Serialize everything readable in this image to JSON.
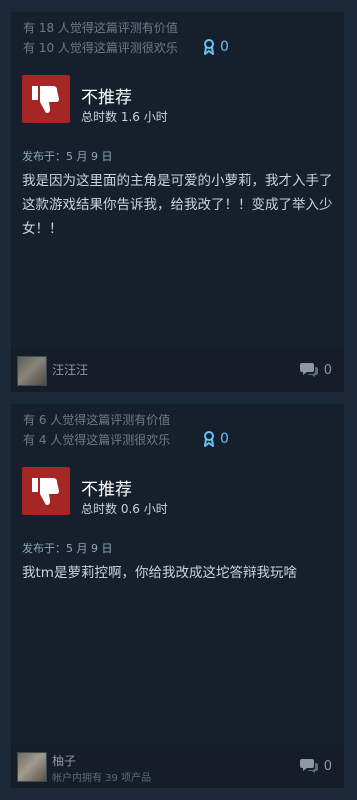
{
  "reviews": [
    {
      "helpful_yes": "有 18 人觉得这篇评测有价值",
      "helpful_funny": "有 10 人觉得这篇评测很欢乐",
      "awards_count": "0",
      "recommendation": "不推荐",
      "hours": "总时数 1.6 小时",
      "posted": "发布于：5 月 9 日",
      "text": "我是因为这里面的主角是可爱的小萝莉，我才入手了这款游戏结果你告诉我，给我改了！！变成了举入少女！！",
      "author": "汪汪汪",
      "comments_count": "0"
    },
    {
      "helpful_yes": "有 6 人觉得这篇评测有价值",
      "helpful_funny": "有 4 人觉得这篇评测很欢乐",
      "awards_count": "0",
      "recommendation": "不推荐",
      "hours": "总时数 0.6 小时",
      "posted": "发布于：5 月 9 日",
      "text": "我tm是萝莉控啊，你给我改成这坨答辩我玩啥",
      "author": "柚子",
      "owned": "帐户内拥有 39 项产品",
      "comments_count": "0"
    }
  ],
  "colors": {
    "background": "#1b2838",
    "card": "#16202d",
    "thumb_down": "#a62626",
    "award": "#66c0f4"
  },
  "icons": [
    "award-icon",
    "thumbs-down-icon",
    "avatar",
    "comment-icon"
  ]
}
